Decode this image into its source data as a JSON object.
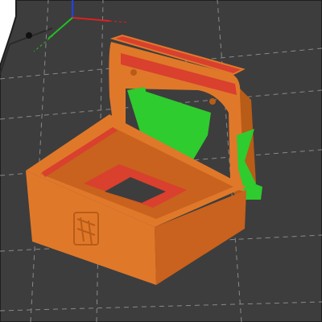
{
  "viewport": {
    "view": "3d-slicer-preview",
    "colors": {
      "background": "#ffffff",
      "bed": "#3d3d3d",
      "bed_border": "#1e1e1e",
      "grid": "#888888",
      "perimeter": "#e0782a",
      "perimeter_dark": "#b85c18",
      "infill": "#d9402d",
      "support": "#2ecc2e",
      "axis_x": "#e02020",
      "axis_y": "#20c020",
      "axis_z": "#2040ff"
    },
    "icons": [
      "axis-gizmo-icon",
      "bed-logo-icon"
    ]
  }
}
